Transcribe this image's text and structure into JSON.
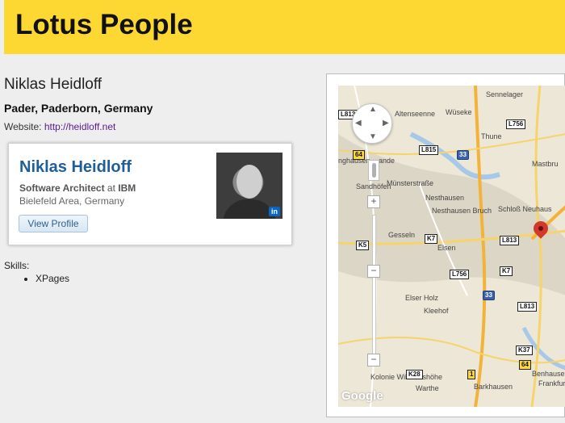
{
  "header": {
    "title": "Lotus People"
  },
  "profile": {
    "name": "Niklas Heidloff",
    "location": "Pader, Paderborn, Germany",
    "website_label": "Website: ",
    "website_url": "http://heidloff.net"
  },
  "card": {
    "name": "Niklas Heidloff",
    "role": "Software Architect",
    "at_text": " at ",
    "company": "IBM",
    "area": "Bielefeld Area, Germany",
    "button": "View Profile",
    "badge": "in"
  },
  "skills": {
    "label": "Skills:",
    "items": [
      "XPages"
    ]
  },
  "map": {
    "places": [
      "Sennelager",
      "Altenseenne",
      "Wüseke",
      "Thune",
      "Mastbru",
      "Münsterstraße",
      "Sandhöfen",
      "Nesthausen",
      "Nesthausen Bruch",
      "Schloß Neuhaus",
      "Gesseln",
      "Elsen",
      "Elser Holz",
      "Kleehof",
      "Kolonie Wilhelmshöhe",
      "Warthe",
      "Barkhausen",
      "Benhausen",
      "Frankfurt",
      "nghausen",
      "ande"
    ],
    "shields": [
      "L813",
      "L756",
      "L815",
      "33",
      "64",
      "K5",
      "K7",
      "L813",
      "K7",
      "L756",
      "33",
      "L813",
      "K37",
      "1",
      "K28",
      "64"
    ],
    "zoom_plus": "+",
    "zoom_minus": "−",
    "attribution": "Google"
  },
  "colors": {
    "header_bg": "#fdd833",
    "card_name": "#1f5f99",
    "link": "#5b1a92"
  }
}
